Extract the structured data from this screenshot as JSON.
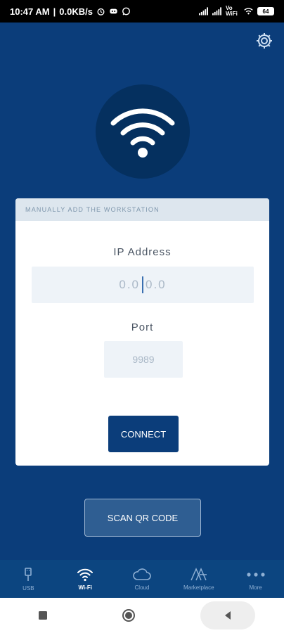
{
  "status_bar": {
    "time": "10:47 AM",
    "net_speed": "0.0KB/s",
    "network_label": "Vo WiFi",
    "battery_level": "64",
    "icons": [
      "alarm-icon",
      "discord-icon",
      "whatsapp-icon",
      "signal-icon",
      "signal-icon",
      "wifi-icon",
      "battery-icon"
    ]
  },
  "header": {
    "settings_icon": "gear-icon"
  },
  "hero": {
    "icon": "wifi-icon"
  },
  "card": {
    "header_label": "MANUALLY ADD THE WORKSTATION",
    "ip_label": "IP Address",
    "ip_placeholder_left": "0.0",
    "ip_placeholder_right": "0.0",
    "port_label": "Port",
    "port_placeholder": "9989",
    "connect_label": "CONNECT"
  },
  "scan": {
    "label": "SCAN QR CODE"
  },
  "tabs": [
    {
      "label": "USB",
      "icon": "usb-icon",
      "active": false
    },
    {
      "label": "Wi-Fi",
      "icon": "wifi-icon",
      "active": true
    },
    {
      "label": "Cloud",
      "icon": "cloud-icon",
      "active": false
    },
    {
      "label": "Marketplace",
      "icon": "marketplace-icon",
      "active": false
    },
    {
      "label": "More",
      "icon": "more-icon",
      "active": false
    }
  ],
  "colors": {
    "background": "#0b3d7a",
    "card": "#ffffff",
    "tabbar": "#0c4580",
    "accent": "#0b3d7a"
  }
}
